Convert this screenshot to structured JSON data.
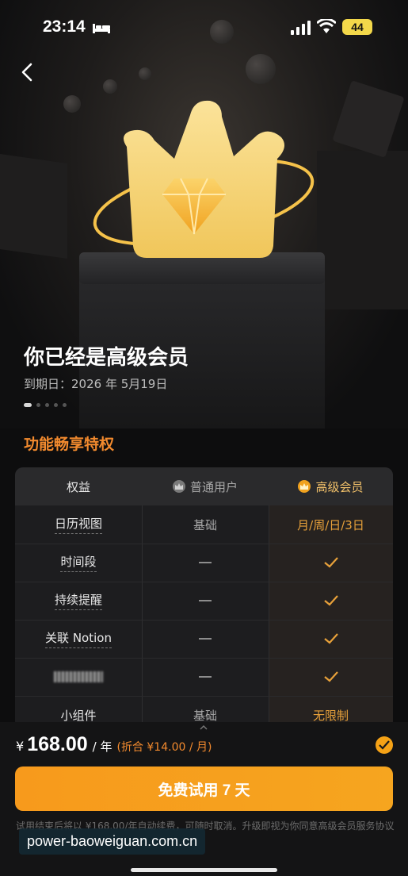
{
  "status_bar": {
    "time": "23:14",
    "battery": "44"
  },
  "hero": {
    "title": "你已经是高级会员",
    "expiry": "到期日：2026 年 5月19日",
    "carousel_count": 5,
    "carousel_active": 0
  },
  "section_title": "功能畅享特权",
  "table": {
    "header": {
      "benefit": "权益",
      "basic": "普通用户",
      "premium": "高级会员"
    },
    "rows": [
      {
        "feature": "日历视图",
        "basic": "基础",
        "premium": "月/周/日/3日"
      },
      {
        "feature": "时间段",
        "basic": "—",
        "premium": "✓"
      },
      {
        "feature": "持续提醒",
        "basic": "—",
        "premium": "✓"
      },
      {
        "feature": "关联 Notion",
        "basic": "—",
        "premium": "✓"
      },
      {
        "feature": "",
        "basic": "—",
        "premium": "✓"
      },
      {
        "feature": "小组件",
        "basic": "基础",
        "premium": "无限制"
      }
    ]
  },
  "purchase": {
    "currency": "¥",
    "price": "168.00",
    "period": "/ 年",
    "equivalent": "(折合 ¥14.00 / 月)",
    "cta_label": "免费试用 7 天",
    "notice": "试用结束后将以 ¥168.00/年自动续费，可随时取消。升级即视为你同意高级会员服务协议"
  },
  "watermark": "power-baoweiguan.com.cn",
  "colors": {
    "accent": "#f28a2e",
    "cta": "#f79a1c",
    "gold": "#e8a13a"
  }
}
